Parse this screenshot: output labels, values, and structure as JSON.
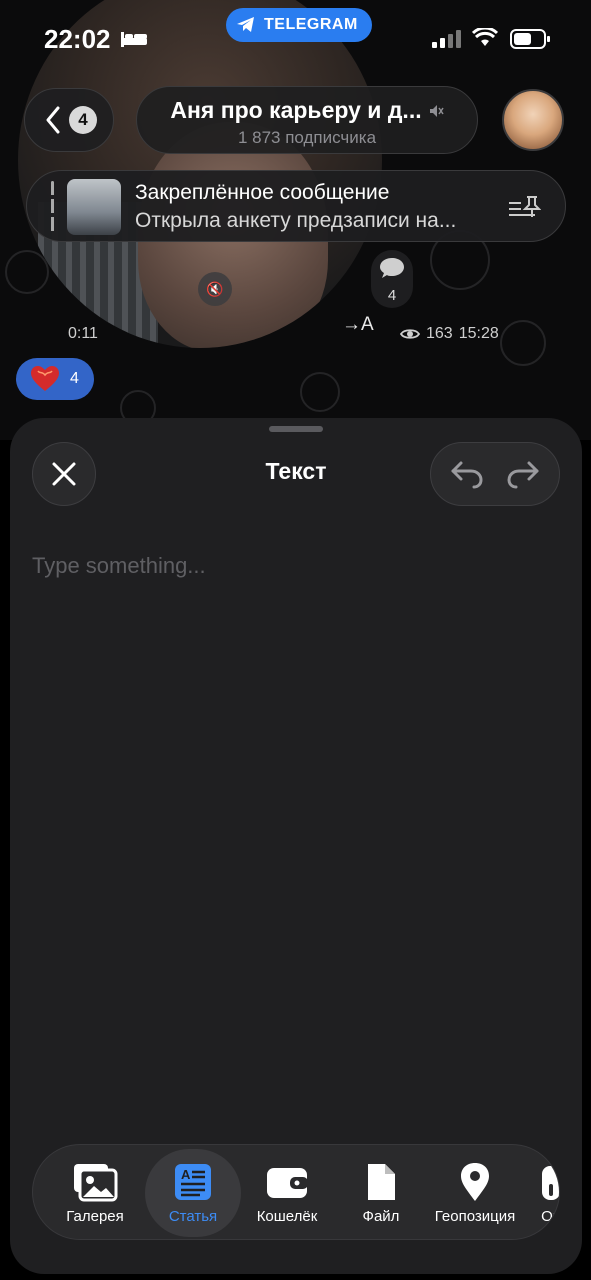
{
  "status_bar": {
    "time": "22:02",
    "app_pill": "TELEGRAM"
  },
  "header": {
    "back_count": "4",
    "channel_title": "Аня про карьеру и д...",
    "subscribers": "1 873 подписчика"
  },
  "pinned": {
    "title": "Закреплённое сообщение",
    "text": "Открыла анкету предзаписи на..."
  },
  "message": {
    "comment_count": "4",
    "duration": "0:11",
    "translate_label": "→A",
    "views": "163",
    "time": "15:28",
    "reaction_count": "4"
  },
  "sheet": {
    "title": "Текст",
    "placeholder": "Type something..."
  },
  "tabs": [
    {
      "label": "Галерея",
      "icon": "gallery-icon",
      "active": false
    },
    {
      "label": "Статья",
      "icon": "article-icon",
      "active": true
    },
    {
      "label": "Кошелёк",
      "icon": "wallet-icon",
      "active": false
    },
    {
      "label": "Файл",
      "icon": "file-icon",
      "active": false
    },
    {
      "label": "Геопозиция",
      "icon": "location-icon",
      "active": false
    },
    {
      "label": "Оп",
      "icon": "poll-icon",
      "active": false
    }
  ],
  "colors": {
    "accent": "#3d8cf5",
    "telegram_pill": "#2a7df0",
    "reaction_bg": "#3365c8",
    "sheet_bg": "#1f1f21"
  }
}
